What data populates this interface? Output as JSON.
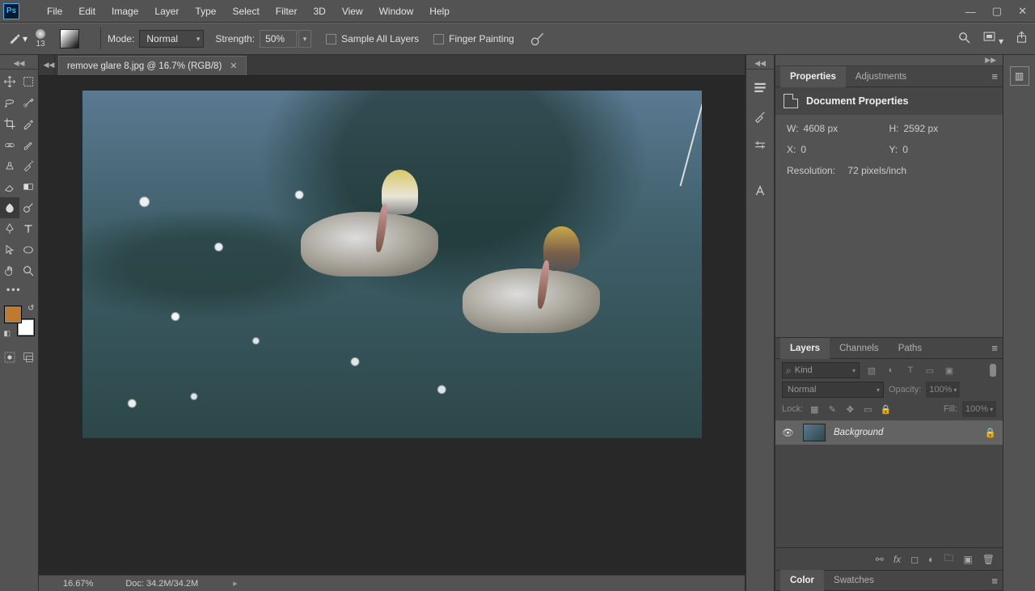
{
  "menu": {
    "items": [
      "File",
      "Edit",
      "Image",
      "Layer",
      "Type",
      "Select",
      "Filter",
      "3D",
      "View",
      "Window",
      "Help"
    ],
    "app": "Ps"
  },
  "options": {
    "brush_size": "13",
    "mode_label": "Mode:",
    "mode_value": "Normal",
    "strength_label": "Strength:",
    "strength_value": "50%",
    "sample_all_label": "Sample All Layers",
    "finger_label": "Finger Painting"
  },
  "tab": {
    "title": "remove glare 8.jpg @ 16.7% (RGB/8)"
  },
  "status": {
    "zoom": "16.67%",
    "doc": "Doc: 34.2M/34.2M"
  },
  "properties": {
    "tab1": "Properties",
    "tab2": "Adjustments",
    "title": "Document Properties",
    "w_label": "W:",
    "w_value": "4608 px",
    "h_label": "H:",
    "h_value": "2592 px",
    "x_label": "X:",
    "x_value": "0",
    "y_label": "Y:",
    "y_value": "0",
    "res_label": "Resolution:",
    "res_value": "72 pixels/inch"
  },
  "layers": {
    "tab1": "Layers",
    "tab2": "Channels",
    "tab3": "Paths",
    "kind": "Kind",
    "blend": "Normal",
    "opacity_label": "Opacity:",
    "opacity_value": "100%",
    "lock_label": "Lock:",
    "fill_label": "Fill:",
    "fill_value": "100%",
    "layer0": {
      "name": "Background"
    }
  },
  "color": {
    "tab1": "Color",
    "tab2": "Swatches"
  },
  "colors": {
    "foreground": "#c07a30",
    "background": "#ffffff"
  }
}
